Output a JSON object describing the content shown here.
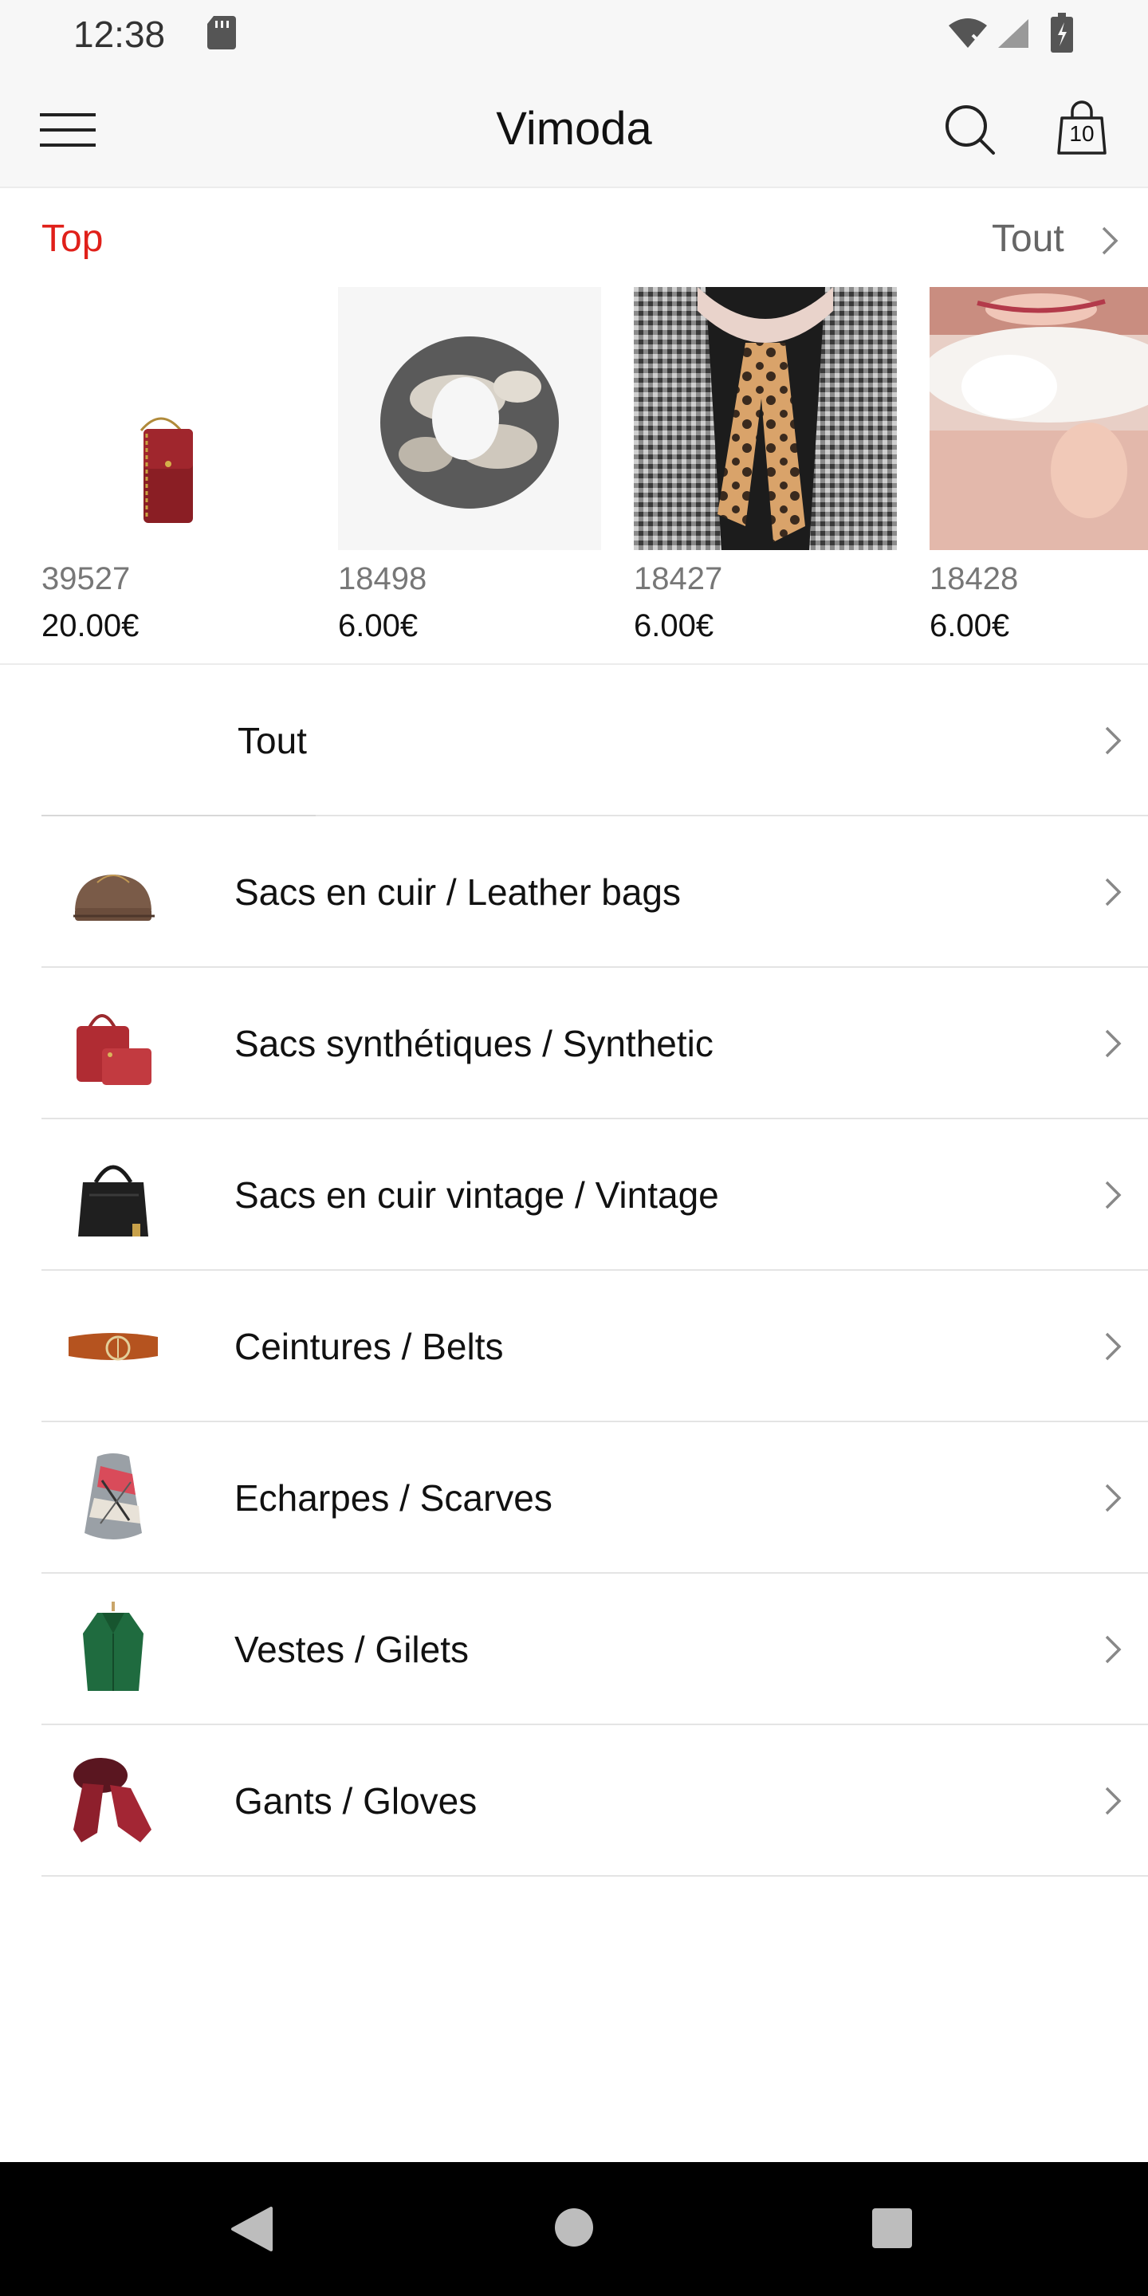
{
  "status_bar": {
    "time": "12:38"
  },
  "header": {
    "title": "Vimoda",
    "cart_count": "10"
  },
  "top_section": {
    "label": "Top",
    "see_all_label": "Tout",
    "products": [
      {
        "id": "39527",
        "price": "20.00€"
      },
      {
        "id": "18498",
        "price": "6.00€"
      },
      {
        "id": "18427",
        "price": "6.00€"
      },
      {
        "id": "18428",
        "price": "6.00€"
      }
    ]
  },
  "categories": [
    {
      "label": "Tout"
    },
    {
      "label": "Sacs en cuir / Leather bags"
    },
    {
      "label": "Sacs synthétiques / Synthetic"
    },
    {
      "label": "Sacs en cuir vintage / Vintage"
    },
    {
      "label": "Ceintures / Belts"
    },
    {
      "label": "Echarpes / Scarves"
    },
    {
      "label": "Vestes / Gilets"
    },
    {
      "label": "Gants / Gloves"
    }
  ],
  "colors": {
    "accent": "#e0201a",
    "text": "#111111",
    "muted": "#777777",
    "nav_bg": "#000000"
  }
}
